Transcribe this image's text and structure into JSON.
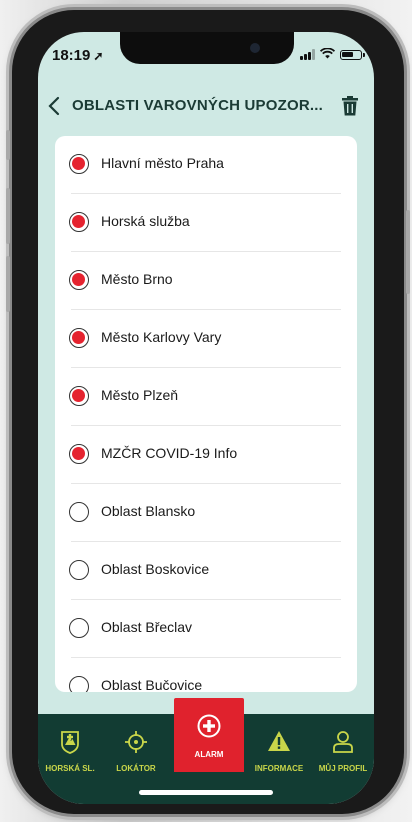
{
  "status_bar": {
    "time": "18:19"
  },
  "header": {
    "title": "OBLASTI VAROVNÝCH UPOZOR..."
  },
  "list": {
    "items": [
      {
        "label": "Hlavní město Praha",
        "selected": true
      },
      {
        "label": "Horská služba",
        "selected": true
      },
      {
        "label": "Město Brno",
        "selected": true
      },
      {
        "label": "Město Karlovy Vary",
        "selected": true
      },
      {
        "label": "Město Plzeň",
        "selected": true
      },
      {
        "label": "MZČR COVID-19 Info",
        "selected": true
      },
      {
        "label": "Oblast Blansko",
        "selected": false
      },
      {
        "label": "Oblast Boskovice",
        "selected": false
      },
      {
        "label": "Oblast Břeclav",
        "selected": false
      },
      {
        "label": "Oblast Bučovice",
        "selected": false
      }
    ]
  },
  "tabs": [
    {
      "label": "HORSKÁ SL.",
      "icon": "mountain-rescue-icon"
    },
    {
      "label": "LOKÁTOR",
      "icon": "crosshair-icon"
    },
    {
      "label": "ALARM",
      "icon": "plus-circle-icon",
      "active": true
    },
    {
      "label": "INFORMACE",
      "icon": "warning-icon"
    },
    {
      "label": "MŮJ PROFIL",
      "icon": "user-icon"
    }
  ],
  "colors": {
    "accent_red": "#e0222d",
    "tabbar_green": "#123c33",
    "tab_label_yellow": "#c9d64a",
    "background_mint": "#cfe9e4"
  }
}
